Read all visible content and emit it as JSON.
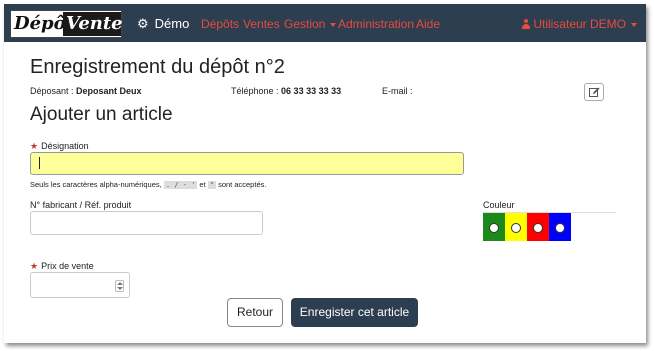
{
  "navbar": {
    "logo": {
      "part1": "Dépôt",
      "part2": "Vente"
    },
    "brand": "Démo",
    "links": [
      "Dépôts",
      "Ventes",
      "Gestion",
      "Administration",
      "Aide"
    ],
    "user": "Utilisateur DEMO"
  },
  "page": {
    "title": "Enregistrement du dépôt n°2",
    "depositor_label": "Déposant : ",
    "depositor_value": "Deposant Deux",
    "phone_label": "Téléphone : ",
    "phone_value": "06 33 33 33 33",
    "email_label": "E-mail :",
    "section_title": "Ajouter un article"
  },
  "form": {
    "designation_label": "Désignation",
    "designation_value": "",
    "hint_prefix": "Seuls les caractères alpha-numériques, ",
    "hint_codes": ". / - '",
    "hint_and": " et ",
    "hint_code2": "\"",
    "hint_suffix": " sont acceptés.",
    "manufacturer_label": "N° fabricant / Réf. produit",
    "manufacturer_value": "",
    "color_label": "Couleur",
    "colors": [
      {
        "name": "green",
        "hex": "#1a8a1a"
      },
      {
        "name": "yellow",
        "hex": "#ffff00"
      },
      {
        "name": "red",
        "hex": "#ff0000"
      },
      {
        "name": "blue",
        "hex": "#0000ff"
      }
    ],
    "price_label": "Prix de vente",
    "price_value": ""
  },
  "buttons": {
    "back": "Retour",
    "save": "Enregister cet article"
  }
}
